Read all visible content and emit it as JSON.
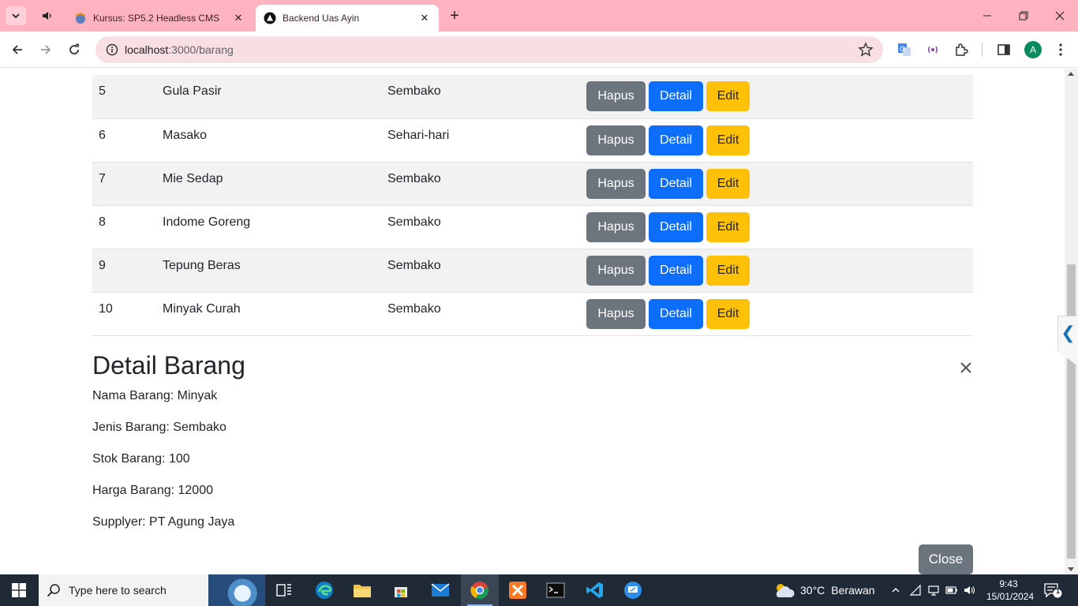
{
  "browser": {
    "tabs": [
      {
        "title": "Kursus: SP5.2 Headless CMS",
        "active": false
      },
      {
        "title": "Backend Uas Ayin",
        "active": true
      }
    ],
    "url_host": "localhost",
    "url_path": ":3000/barang",
    "profile_initial": "A"
  },
  "table": {
    "rows": [
      {
        "no": "5",
        "nama": "Gula Pasir",
        "jenis": "Sembako"
      },
      {
        "no": "6",
        "nama": "Masako",
        "jenis": "Sehari-hari"
      },
      {
        "no": "7",
        "nama": "Mie Sedap",
        "jenis": "Sembako"
      },
      {
        "no": "8",
        "nama": "Indome Goreng",
        "jenis": "Sembako"
      },
      {
        "no": "9",
        "nama": "Tepung Beras",
        "jenis": "Sembako"
      },
      {
        "no": "10",
        "nama": "Minyak Curah",
        "jenis": "Sembako"
      }
    ],
    "buttons": {
      "hapus": "Hapus",
      "detail": "Detail",
      "edit": "Edit"
    }
  },
  "detail": {
    "title": "Detail Barang",
    "lines": [
      "Nama Barang: Minyak",
      "Jenis Barang: Sembako",
      "Stok Barang: 100",
      "Harga Barang: 12000",
      "Supplyer: PT Agung Jaya"
    ],
    "close_label": "Close"
  },
  "taskbar": {
    "search_placeholder": "Type here to search",
    "weather_temp": "30°C",
    "weather_desc": "Berawan",
    "time": "9:43",
    "date": "15/01/2024",
    "notification_count": "1"
  },
  "colors": {
    "tabstrip": "#ffb3c0",
    "btn_secondary": "#6c757d",
    "btn_primary": "#0d6efd",
    "btn_warning": "#ffc107"
  }
}
